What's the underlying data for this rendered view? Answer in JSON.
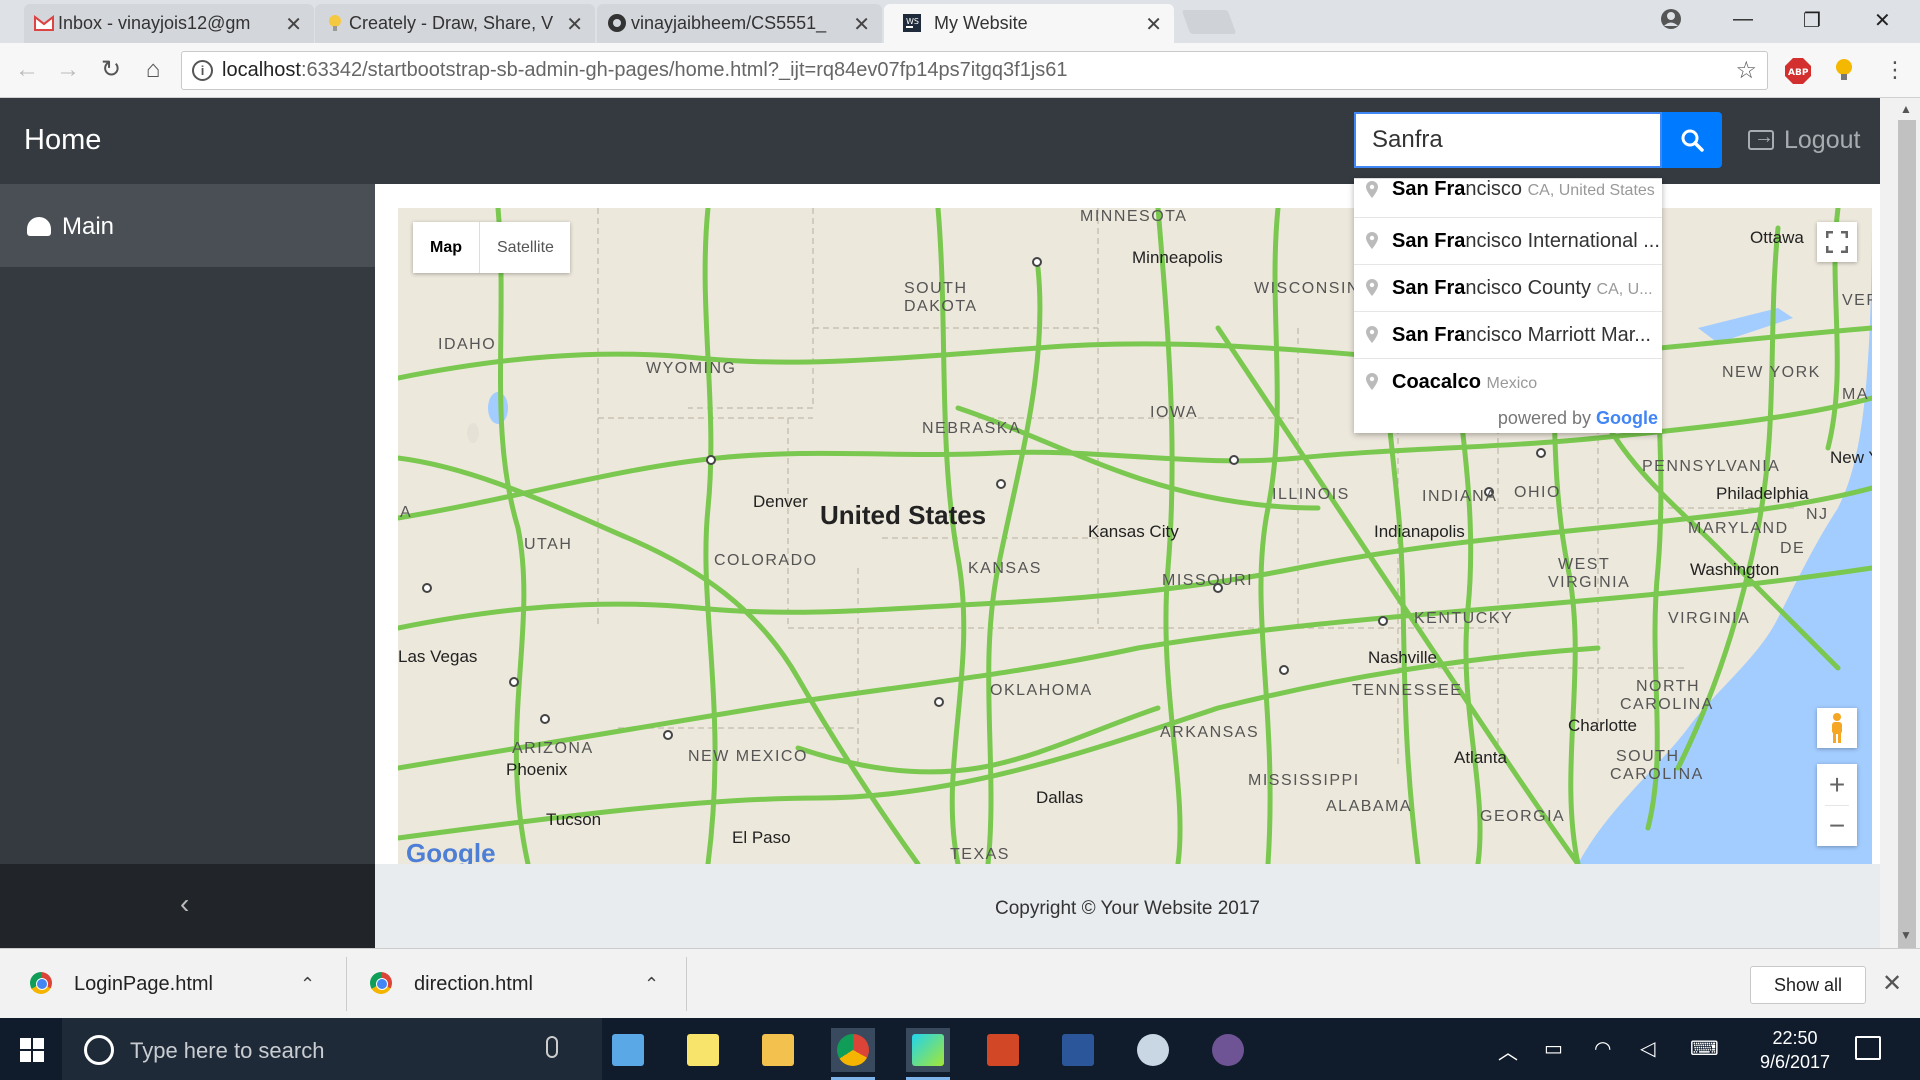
{
  "browser": {
    "tabs": [
      {
        "title": "Inbox - vinayjois12@gm",
        "icon": "gmail-icon"
      },
      {
        "title": "Creately - Draw, Share, V",
        "icon": "creately-icon"
      },
      {
        "title": "vinayjaibheem/CS5551_",
        "icon": "github-icon"
      },
      {
        "title": "My Website",
        "icon": "webstorm-icon"
      }
    ],
    "url_host": "localhost",
    "url_path": ":63342/startbootstrap-sb-admin-gh-pages/home.html?_ijt=rq84ev07fp14ps7itgq3f1js61"
  },
  "app": {
    "brand": "Home",
    "search_value": "Sanfra",
    "logout_label": "Logout",
    "sidebar": {
      "main_label": "Main",
      "toggle_icon": "chevron-left-icon"
    },
    "footer": "Copyright © Your Website 2017",
    "accent_color": "#007bff",
    "nav_color": "#343a40"
  },
  "map": {
    "type_buttons": {
      "map": "Map",
      "satellite": "Satellite"
    },
    "country": "United States",
    "states": [
      "MINNESOTA",
      "SOUTH",
      "DAKOTA",
      "WISCONSIN",
      "IDAHO",
      "WYOMING",
      "IOWA",
      "NEBRASKA",
      "ILLINOIS",
      "INDIANA",
      "OHIO",
      "PENNSYLVANIA",
      "NEW YORK",
      "UTAH",
      "COLORADO",
      "KANSAS",
      "MISSOURI",
      "WEST",
      "VIRGINIA",
      "MARYLAND",
      "DE",
      "KENTUCKY",
      "VIRGINIA",
      "TENNESSEE",
      "NORTH",
      "CAROLINA",
      "OKLAHOMA",
      "ARKANSAS",
      "ARIZONA",
      "NEW MEXICO",
      "MISSISSIPPI",
      "ALABAMA",
      "GEORGIA",
      "SOUTH",
      "CAROLINA",
      "TEXAS",
      "NJ",
      "VER",
      "MA",
      "A"
    ],
    "cities": [
      "Minneapolis",
      "Ottawa",
      "Denver",
      "Kansas City",
      "Indianapolis",
      "Philadelphia",
      "New York",
      "Washington",
      "Las Vegas",
      "Nashville",
      "Charlotte",
      "Phoenix",
      "Atlanta",
      "Dallas",
      "Tucson",
      "El Paso"
    ],
    "road_color": "#7ac84f",
    "attribution": "Google"
  },
  "autocomplete": {
    "items": [
      {
        "match": "San Fra",
        "rest": "ncisco",
        "secondary": "CA, United States"
      },
      {
        "match": "San Fra",
        "rest": "ncisco International ...",
        "secondary": ""
      },
      {
        "match": "San Fra",
        "rest": "ncisco County",
        "secondary": "CA, U..."
      },
      {
        "match": "San Fra",
        "rest": "ncisco Marriott Mar...",
        "secondary": ""
      },
      {
        "match": "Coacalco",
        "rest": "",
        "secondary": "Mexico"
      }
    ],
    "powered_by": "powered by",
    "powered_brand": "Google"
  },
  "downloads": {
    "items": [
      "LoginPage.html",
      "direction.html"
    ],
    "show_all": "Show all"
  },
  "taskbar": {
    "search_placeholder": "Type here to search",
    "time": "22:50",
    "date": "9/6/2017"
  }
}
